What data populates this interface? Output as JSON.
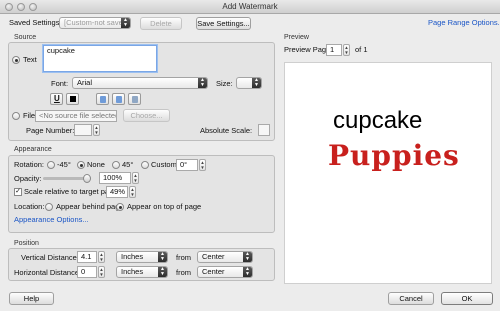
{
  "window": {
    "title": "Add Watermark"
  },
  "top": {
    "saved_settings_label": "Saved Settings:",
    "saved_settings_value": "[Custom-not saved]",
    "delete_label": "Delete",
    "save_settings_label": "Save Settings...",
    "page_range_label": "Page Range Options..."
  },
  "source": {
    "section_title": "Source",
    "text_label": "Text",
    "text_value": "cupcake",
    "font_label": "Font:",
    "font_value": "Arial",
    "size_label": "Size:",
    "size_value": "",
    "file_label": "File",
    "file_value": "<No source file selected>",
    "choose_label": "Choose...",
    "page_number_label": "Page Number:",
    "page_number_value": "",
    "absolute_scale_label": "Absolute Scale:",
    "absolute_scale_value": ""
  },
  "appearance": {
    "section_title": "Appearance",
    "rotation_label": "Rotation:",
    "rot_minus45": "-45°",
    "rot_none": "None",
    "rot_45": "45°",
    "rot_custom": "Custom",
    "rot_custom_value": "0°",
    "opacity_label": "Opacity:",
    "opacity_value": "100%",
    "opacity_fraction": 1.0,
    "scale_label": "Scale relative to target page",
    "scale_value": "49%",
    "location_label": "Location:",
    "loc_behind": "Appear behind page",
    "loc_top": "Appear on top of page",
    "appearance_options_label": "Appearance Options..."
  },
  "position": {
    "section_title": "Position",
    "vertical_label": "Vertical Distance:",
    "vertical_value": "4.1",
    "vertical_units": "Inches",
    "vertical_from": "from",
    "vertical_anchor": "Center",
    "horizontal_label": "Horizontal Distance:",
    "horizontal_value": "0",
    "horizontal_units": "Inches",
    "horizontal_from": "from",
    "horizontal_anchor": "Center"
  },
  "preview": {
    "section_title": "Preview",
    "page_label": "Preview Page",
    "page_value": "1",
    "of_label": "of 1",
    "watermark_text": "cupcake",
    "image_text": "Puppies",
    "image_color": "#c8201d"
  },
  "footer": {
    "help_label": "Help",
    "cancel_label": "Cancel",
    "ok_label": "OK"
  }
}
